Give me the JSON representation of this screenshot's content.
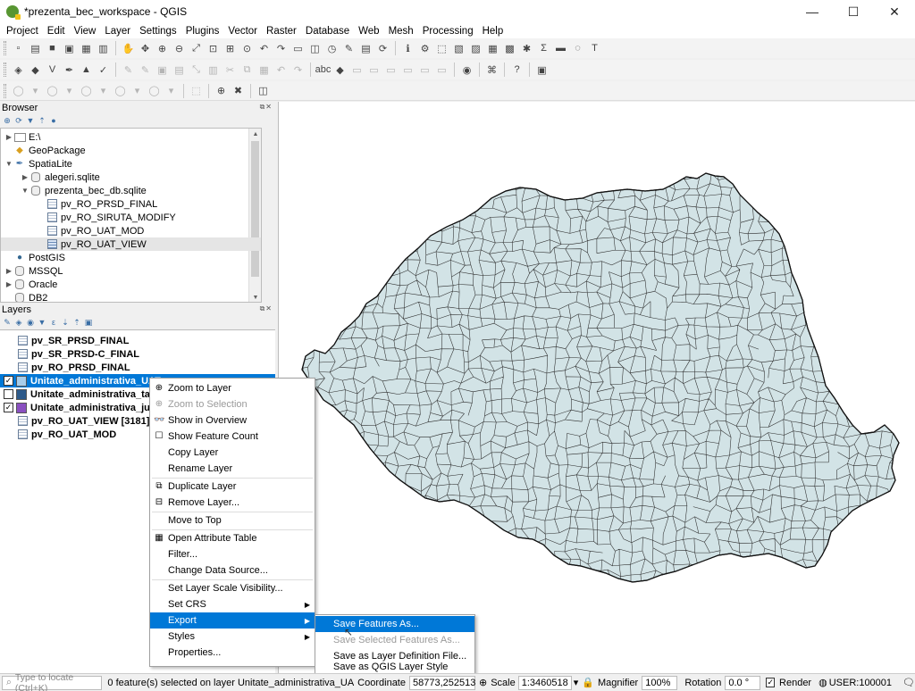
{
  "window": {
    "title": "*prezenta_bec_workspace - QGIS",
    "controls": [
      "—",
      "☐",
      "✕"
    ]
  },
  "menubar": [
    "Project",
    "Edit",
    "View",
    "Layer",
    "Settings",
    "Plugins",
    "Vector",
    "Raster",
    "Database",
    "Web",
    "Mesh",
    "Processing",
    "Help"
  ],
  "browser": {
    "title": "Browser",
    "items": [
      {
        "label": "E:\\",
        "depth": 0,
        "expander": "▶",
        "icon": "folder-icon"
      },
      {
        "label": "GeoPackage",
        "depth": 0,
        "expander": "",
        "icon": "geopackage-icon"
      },
      {
        "label": "SpatiaLite",
        "depth": 0,
        "expander": "▼",
        "icon": "feather-icon"
      },
      {
        "label": "alegeri.sqlite",
        "depth": 1,
        "expander": "▶",
        "icon": "database-icon"
      },
      {
        "label": "prezenta_bec_db.sqlite",
        "depth": 1,
        "expander": "▼",
        "icon": "database-icon"
      },
      {
        "label": "pv_RO_PRSD_FINAL",
        "depth": 2,
        "expander": "",
        "icon": "table-icon"
      },
      {
        "label": "pv_RO_SIRUTA_MODIFY",
        "depth": 2,
        "expander": "",
        "icon": "table-icon"
      },
      {
        "label": "pv_RO_UAT_MOD",
        "depth": 2,
        "expander": "",
        "icon": "table-icon"
      },
      {
        "label": "pv_RO_UAT_VIEW",
        "depth": 2,
        "expander": "",
        "icon": "table-icon",
        "selected": true
      },
      {
        "label": "PostGIS",
        "depth": 0,
        "expander": "",
        "icon": "elephant-icon"
      },
      {
        "label": "MSSQL",
        "depth": 0,
        "expander": "▶",
        "icon": "database-icon"
      },
      {
        "label": "Oracle",
        "depth": 0,
        "expander": "▶",
        "icon": "database-icon"
      },
      {
        "label": "DB2",
        "depth": 0,
        "expander": "",
        "icon": "database-icon"
      }
    ]
  },
  "layers": {
    "title": "Layers",
    "items": [
      {
        "label": "pv_SR_PRSD_FINAL",
        "checkbox": false,
        "swatch": ""
      },
      {
        "label": "pv_SR_PRSD-C_FINAL",
        "checkbox": false,
        "swatch": ""
      },
      {
        "label": "pv_RO_PRSD_FINAL",
        "checkbox": false,
        "swatch": ""
      },
      {
        "label": "Unitate_administrativa_UAT",
        "checkbox": true,
        "checked": "✓",
        "swatch": "#a8cdea",
        "selected": true
      },
      {
        "label": "Unitate_administrativa_ta",
        "checkbox": true,
        "checked": "",
        "swatch": "#2e5a8a"
      },
      {
        "label": "Unitate_administrativa_ju",
        "checkbox": true,
        "checked": "✓",
        "swatch": "#8a50c0"
      },
      {
        "label": "pv_RO_UAT_VIEW [3181]",
        "checkbox": false,
        "swatch": ""
      },
      {
        "label": "pv_RO_UAT_MOD",
        "checkbox": false,
        "swatch": ""
      }
    ]
  },
  "context_menu": [
    {
      "label": "Zoom to Layer",
      "icon": "zoom-layer-icon"
    },
    {
      "label": "Zoom to Selection",
      "icon": "zoom-selection-icon",
      "disabled": true
    },
    {
      "label": "Show in Overview",
      "icon": "glasses-icon"
    },
    {
      "label": "Show Feature Count",
      "icon": "checkbox-icon"
    },
    {
      "label": "Copy Layer",
      "icon": ""
    },
    {
      "label": "Rename Layer",
      "icon": ""
    },
    {
      "sep": true
    },
    {
      "label": "Duplicate Layer",
      "icon": "duplicate-icon"
    },
    {
      "label": "Remove Layer...",
      "icon": "remove-icon"
    },
    {
      "sep": true
    },
    {
      "label": "Move to Top",
      "icon": ""
    },
    {
      "sep": true
    },
    {
      "label": "Open Attribute Table",
      "icon": "table-icon"
    },
    {
      "label": "Filter...",
      "icon": ""
    },
    {
      "label": "Change Data Source...",
      "icon": ""
    },
    {
      "sep": true
    },
    {
      "label": "Set Layer Scale Visibility...",
      "icon": ""
    },
    {
      "label": "Set CRS",
      "icon": "",
      "submenu": true
    },
    {
      "label": "Export",
      "icon": "",
      "submenu": true,
      "highlighted": true
    },
    {
      "label": "Styles",
      "icon": "",
      "submenu": true
    },
    {
      "label": "Properties...",
      "icon": ""
    }
  ],
  "export_submenu": [
    {
      "label": "Save Features As...",
      "highlighted": true
    },
    {
      "label": "Save Selected Features As...",
      "disabled": true
    },
    {
      "label": "Save as Layer Definition File..."
    },
    {
      "label": "Save as QGIS Layer Style File..."
    }
  ],
  "status": {
    "locate_placeholder": "Type to locate (Ctrl+K)",
    "message": "0 feature(s) selected on layer Unitate_administrativa_UA",
    "coordinate_label": "Coordinate",
    "coordinate_value": "58773,252513",
    "scale_label": "Scale",
    "scale_value": "1:3460518",
    "magnifier_label": "Magnifier",
    "magnifier_value": "100%",
    "rotation_label": "Rotation",
    "rotation_value": "0.0 °",
    "render_label": "Render",
    "crs": "USER:100001"
  },
  "map": {
    "fill": "#d2e3e6",
    "stroke": "#222222"
  }
}
